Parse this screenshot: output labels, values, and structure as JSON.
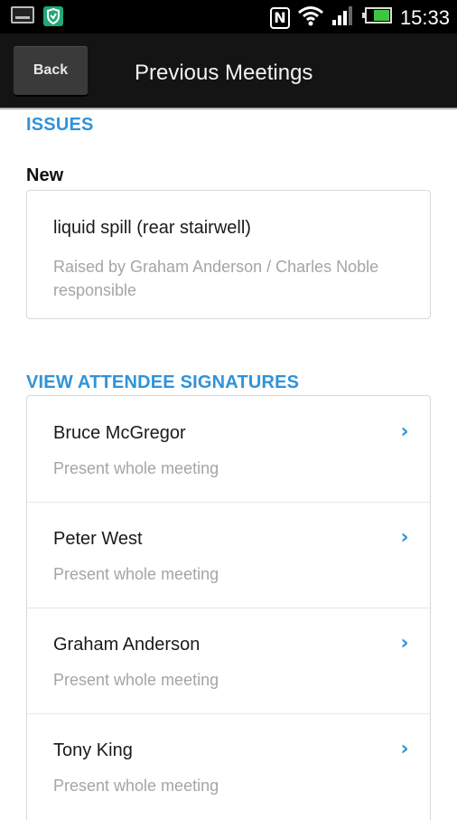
{
  "status_bar": {
    "time": "15:33",
    "icons": [
      "keyboard-icon",
      "shield-icon",
      "nfc-icon",
      "wifi-icon",
      "signal-icon",
      "battery-icon"
    ],
    "nfc_glyph": "N"
  },
  "action_bar": {
    "back_label": "Back",
    "title": "Previous Meetings"
  },
  "issues": {
    "heading": "ISSUES",
    "group_label": "New",
    "items": [
      {
        "title": "liquid spill (rear stairwell)",
        "meta": "Raised by Graham Anderson / Charles Noble responsible"
      }
    ]
  },
  "attendees": {
    "heading": "VIEW ATTENDEE SIGNATURES",
    "items": [
      {
        "name": "Bruce McGregor",
        "status": "Present whole meeting"
      },
      {
        "name": "Peter West",
        "status": "Present whole meeting"
      },
      {
        "name": "Graham Anderson",
        "status": "Present whole meeting"
      },
      {
        "name": "Tony King",
        "status": "Present whole meeting"
      }
    ]
  },
  "colors": {
    "accent": "#2f93d9",
    "actionbar": "#141414",
    "secondary_text": "#a5a5a5",
    "battery_green": "#3ec63e"
  }
}
